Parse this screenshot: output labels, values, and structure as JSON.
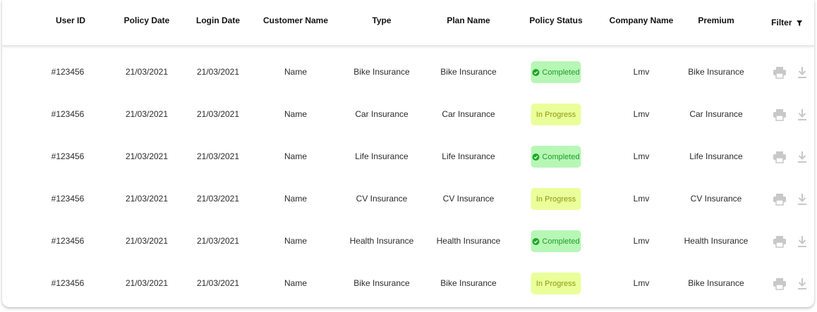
{
  "table": {
    "columns": {
      "user_id": "User ID",
      "policy_date": "Policy Date",
      "login_date": "Login Date",
      "customer_name": "Customer Name",
      "type": "Type",
      "plan_name": "Plan Name",
      "policy_status": "Policy Status",
      "company_name": "Company Name",
      "premium": "Premium",
      "filter": "Filter"
    },
    "rows": [
      {
        "user_id": "#123456",
        "policy_date": "21/03/2021",
        "login_date": "21/03/2021",
        "customer_name": "Name",
        "type": "Bike Insurance",
        "plan_name": "Bike Insurance",
        "status": "Completed",
        "status_kind": "completed",
        "company": "Lmv",
        "premium": "Bike Insurance"
      },
      {
        "user_id": "#123456",
        "policy_date": "21/03/2021",
        "login_date": "21/03/2021",
        "customer_name": "Name",
        "type": "Car Insurance",
        "plan_name": "Car Insurance",
        "status": "In Progress",
        "status_kind": "progress",
        "company": "Lmv",
        "premium": "Car Insurance"
      },
      {
        "user_id": "#123456",
        "policy_date": "21/03/2021",
        "login_date": "21/03/2021",
        "customer_name": "Name",
        "type": "Life Insurance",
        "plan_name": "Life Insurance",
        "status": "Completed",
        "status_kind": "completed",
        "company": "Lmv",
        "premium": "Life Insurance"
      },
      {
        "user_id": "#123456",
        "policy_date": "21/03/2021",
        "login_date": "21/03/2021",
        "customer_name": "Name",
        "type": "CV Insurance",
        "plan_name": "CV Insurance",
        "status": "In Progress",
        "status_kind": "progress",
        "company": "Lmv",
        "premium": "CV Insurance"
      },
      {
        "user_id": "#123456",
        "policy_date": "21/03/2021",
        "login_date": "21/03/2021",
        "customer_name": "Name",
        "type": "Health Insurance",
        "plan_name": "Health Insurance",
        "status": "Completed",
        "status_kind": "completed",
        "company": "Lmv",
        "premium": "Health Insurance"
      },
      {
        "user_id": "#123456",
        "policy_date": "21/03/2021",
        "login_date": "21/03/2021",
        "customer_name": "Name",
        "type": "Bike Insurance",
        "plan_name": "Bike Insurance",
        "status": "In Progress",
        "status_kind": "progress",
        "company": "Lmv",
        "premium": "Bike Insurance"
      }
    ],
    "icons": {
      "filter": "filter-icon",
      "print": "print-icon",
      "download": "download-icon",
      "check": "check-circle-icon"
    },
    "colors": {
      "completed_bg": "#b7f7b6",
      "completed_text": "#1f9c27",
      "progress_bg": "#eaff9a",
      "progress_text": "#8a9a10",
      "action_icon": "#c8c8c8"
    }
  }
}
